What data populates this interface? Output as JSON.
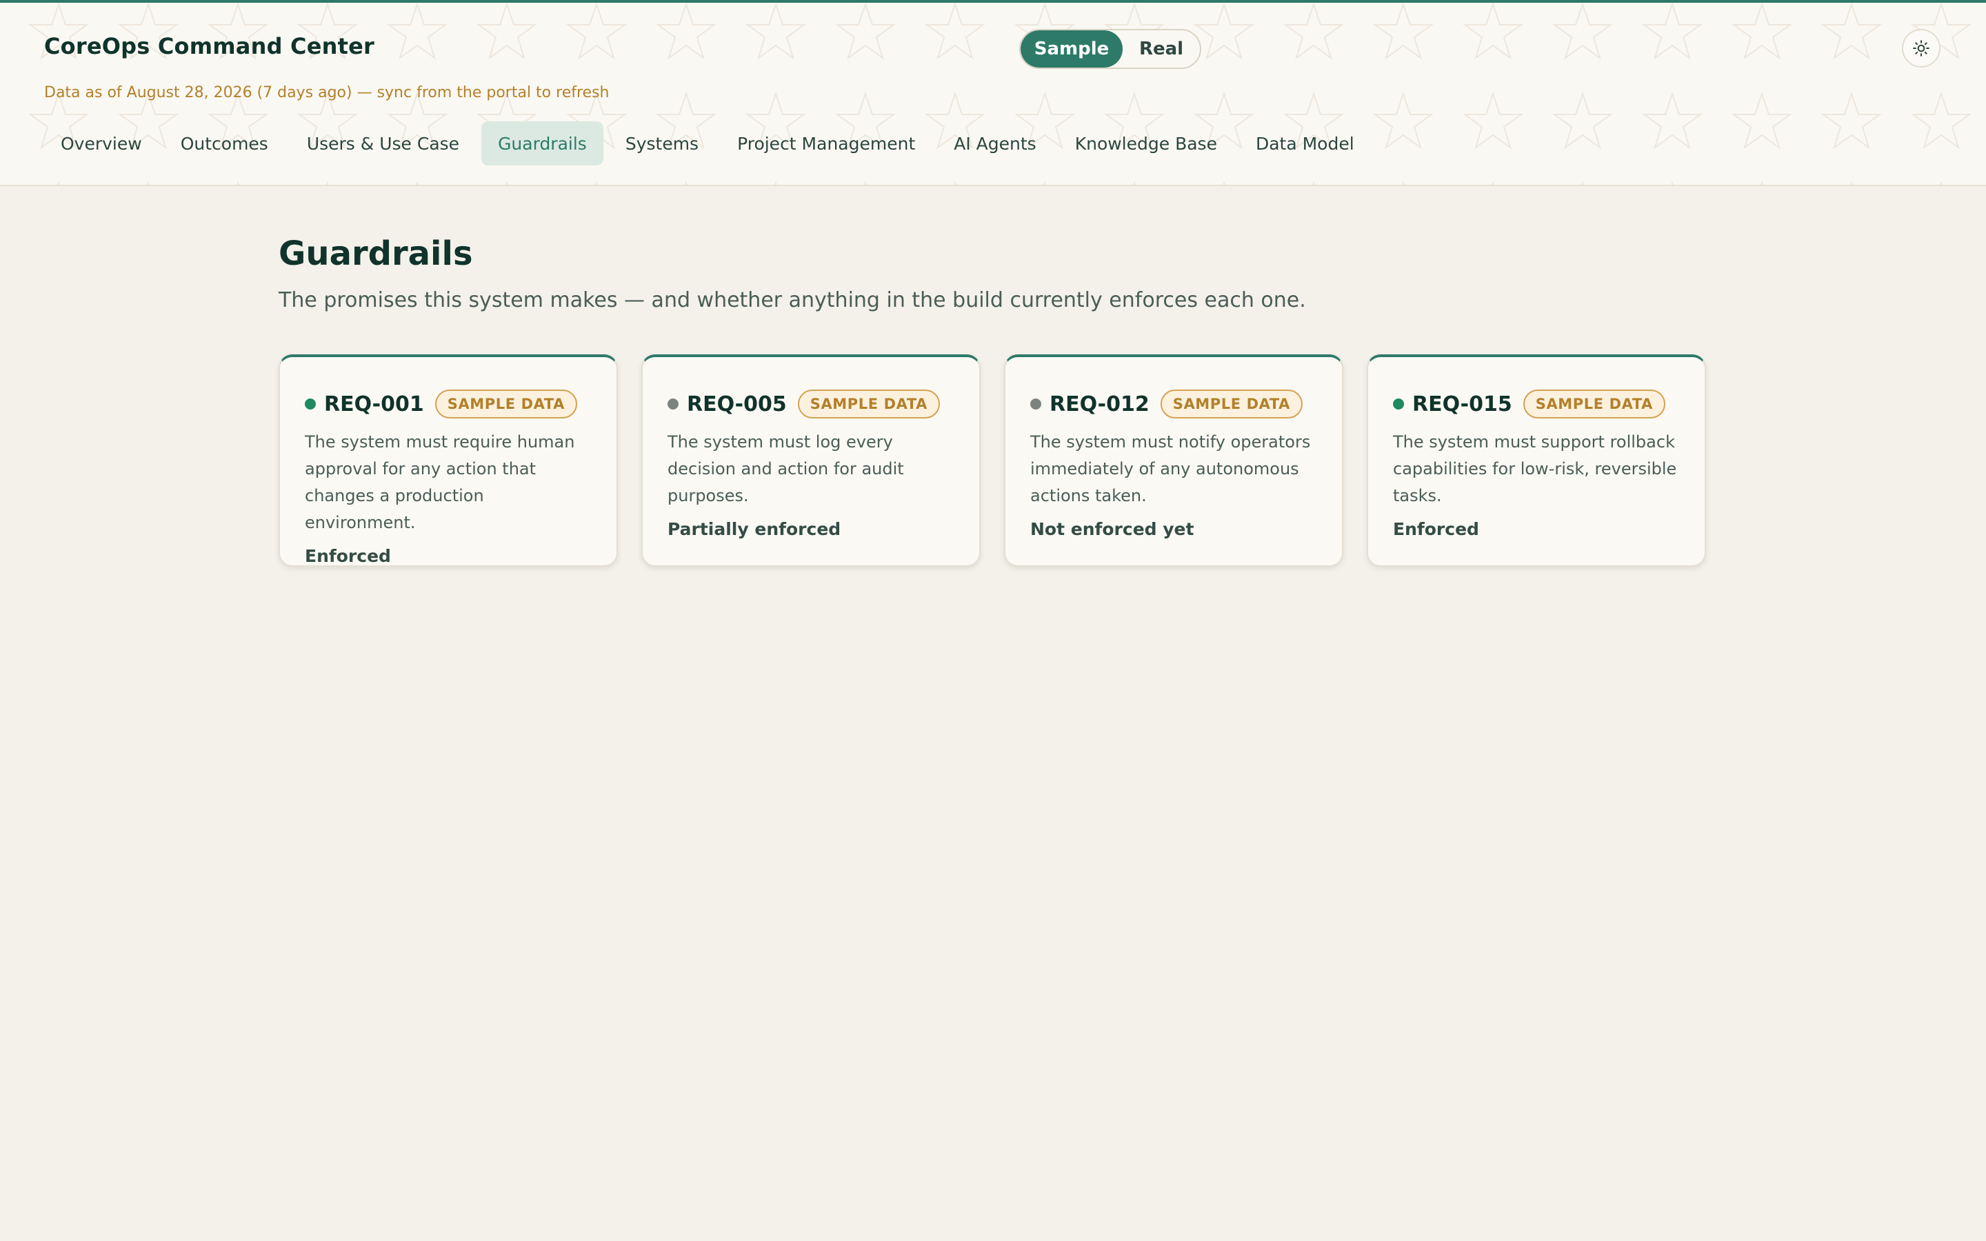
{
  "app": {
    "title": "CoreOps Command Center",
    "sync_note": "Data as of August 28, 2026 (7 days ago) — sync from the portal to refresh"
  },
  "mode_toggle": {
    "options": [
      "Sample",
      "Real"
    ],
    "selected": "Sample"
  },
  "theme_toggle": {
    "icon": "sun-icon"
  },
  "nav": {
    "tabs": [
      {
        "label": "Overview"
      },
      {
        "label": "Outcomes"
      },
      {
        "label": "Users & Use Case"
      },
      {
        "label": "Guardrails"
      },
      {
        "label": "Systems"
      },
      {
        "label": "Project Management"
      },
      {
        "label": "AI Agents"
      },
      {
        "label": "Knowledge Base"
      },
      {
        "label": "Data Model"
      }
    ],
    "active": "Guardrails"
  },
  "page": {
    "title": "Guardrails",
    "subtitle": "The promises this system makes — and whether anything in the build currently enforces each one."
  },
  "guardrails": [
    {
      "id": "REQ-001",
      "badge": "SAMPLE DATA",
      "description": "The system must require human approval for any action that changes a production environment.",
      "status": "Enforced",
      "indicator": "green"
    },
    {
      "id": "REQ-005",
      "badge": "SAMPLE DATA",
      "description": "The system must log every decision and action for audit purposes.",
      "status": "Partially enforced",
      "indicator": "gray"
    },
    {
      "id": "REQ-012",
      "badge": "SAMPLE DATA",
      "description": "The system must notify operators immediately of any autonomous actions taken.",
      "status": "Not enforced yet",
      "indicator": "gray"
    },
    {
      "id": "REQ-015",
      "badge": "SAMPLE DATA",
      "description": "The system must support rollback capabilities for low-risk, reversible tasks.",
      "status": "Enforced",
      "indicator": "green"
    }
  ],
  "colors": {
    "accent": "#2d7a68",
    "badge": "#b3802a",
    "enforced_dot": "#1e8a62",
    "pending_dot": "#7d8480",
    "background": "#f4f1ea"
  }
}
